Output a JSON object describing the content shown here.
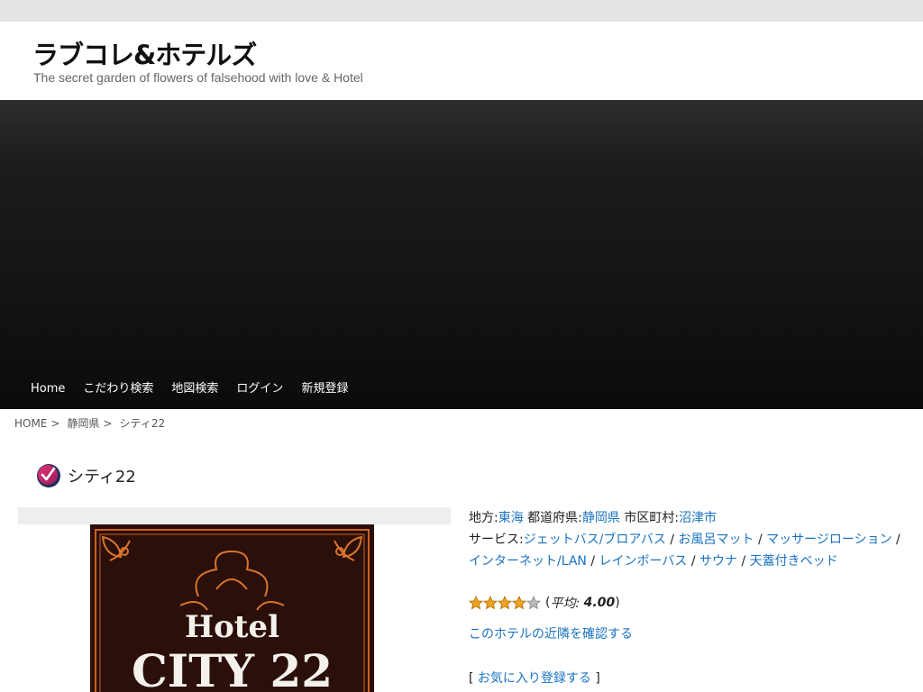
{
  "site": {
    "title": "ラブコレ&ホテルズ",
    "description": "The secret garden of flowers of falsehood with love & Hotel"
  },
  "nav": {
    "items": [
      "Home",
      "こだわり検索",
      "地図検索",
      "ログイン",
      "新規登録"
    ]
  },
  "breadcrumb": {
    "home": "HOME",
    "pref": "静岡県",
    "current": "シティ22",
    "separator": ">"
  },
  "hotel": {
    "name": "シティ22",
    "photo_text_line1": "Hotel",
    "photo_text_line2": "CITY 22",
    "region_label": "地方:",
    "region": "東海",
    "pref_label": "都道府県:",
    "pref": "静岡県",
    "city_label": "市区町村:",
    "city": "沼津市",
    "services_label": "サービス:",
    "services": [
      "ジェットバス/ブロアバス",
      "お風呂マット",
      "マッサージローション",
      "インターネット/LAN",
      "レインボーバス",
      "サウナ",
      "天蓋付きベッド"
    ],
    "service_separator": " / ",
    "rating": {
      "value": 4.0,
      "max": 5,
      "prefix": "(",
      "avg_label": "平均:",
      "avg_value": "4.00",
      "suffix": ")",
      "star_color": "#f2a51a",
      "star_empty_color": "#b8b8b8"
    },
    "nearby_link": "このホテルの近隣を確認する",
    "fav_open": "[",
    "fav_link": "お気に入り登録する",
    "fav_close": "]"
  },
  "colors": {
    "link": "#1a73c2",
    "topbar": "#e4e4e4",
    "hero_dark": "#141414"
  },
  "icons": {
    "title_icon": "check-circle-icon",
    "rating_star": "star-icon"
  }
}
